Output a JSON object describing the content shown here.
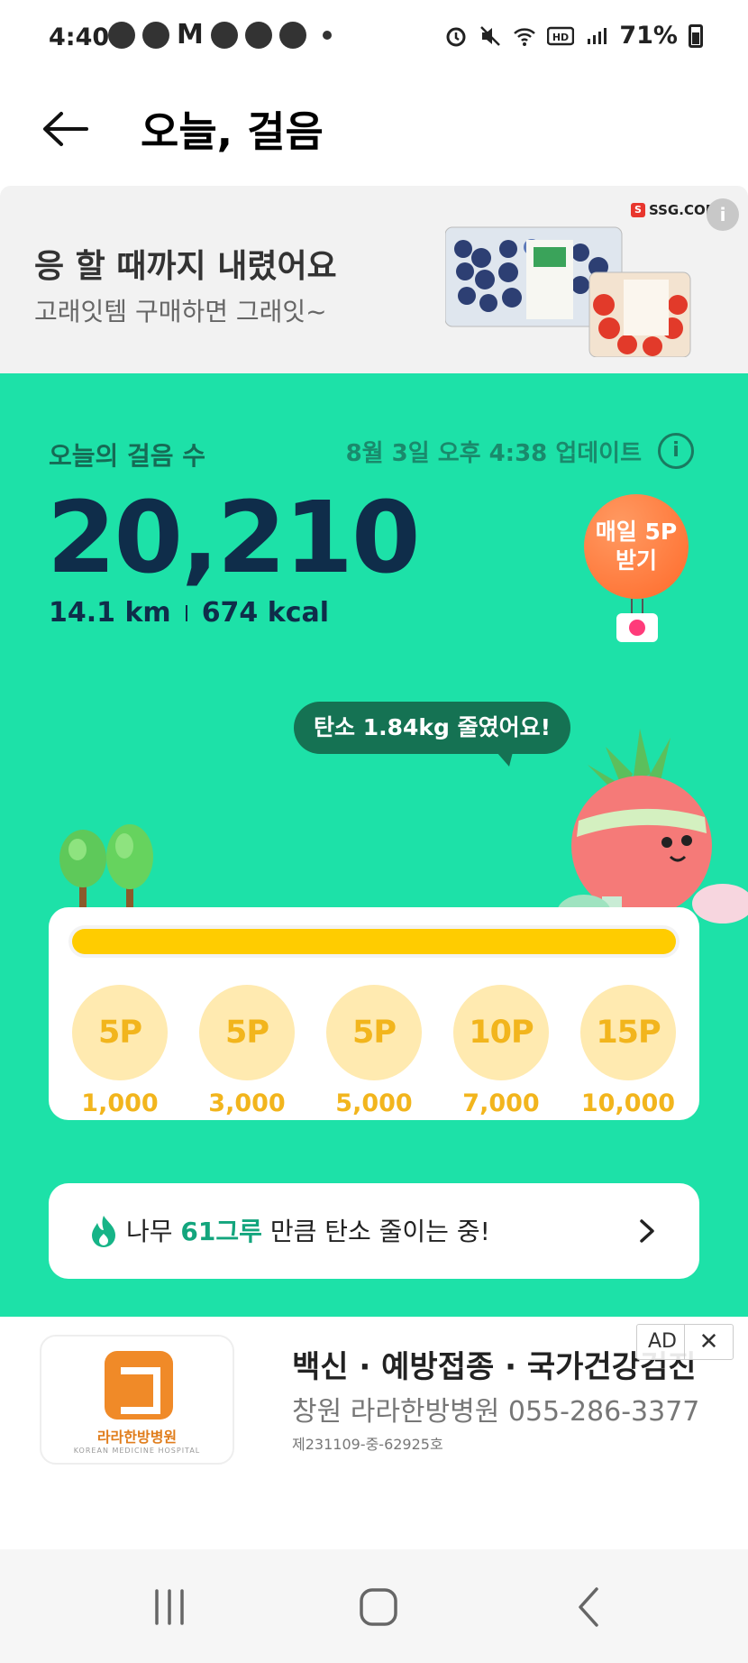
{
  "status_bar": {
    "time": "4:40",
    "notif_letter": "M",
    "battery": "71%"
  },
  "header": {
    "title": "오늘, 걸음"
  },
  "top_ad": {
    "headline": "응 할 때까지 내렸어요",
    "subline": "고래잇템 구매하면 그래잇~",
    "brand": "SSG.COM",
    "info": "i"
  },
  "summary": {
    "label": "오늘의 걸음 수",
    "updated": "8월 3일 오후 4:38 업데이트",
    "steps": "20,210",
    "distance": "14.1 km",
    "calories": "674 kcal",
    "balloon_line1": "매일 5P",
    "balloon_line2": "받기",
    "carbon_bubble": "탄소 1.84kg 줄였어요!",
    "goal_progress_fraction": 1.0
  },
  "milestones": [
    {
      "points": "5P",
      "steps": "1,000"
    },
    {
      "points": "5P",
      "steps": "3,000"
    },
    {
      "points": "5P",
      "steps": "5,000"
    },
    {
      "points": "10P",
      "steps": "7,000"
    },
    {
      "points": "15P",
      "steps": "10,000"
    }
  ],
  "tree_row": {
    "prefix": "나무 ",
    "count": "61그루",
    "suffix": " 만큼 탄소 줄이는 중!"
  },
  "bottom_ad": {
    "logo_name": "라라한방병원",
    "logo_en": "KOREAN MEDICINE HOSPITAL",
    "title": "백신 · 예방접종 · 국가건강검진",
    "subtitle": "창원 라라한방병원 055-286-3377",
    "license": "제231109-중-62925호",
    "badge": "AD",
    "close": "✕"
  },
  "colors": {
    "green_bg": "#1de1a8",
    "steps_text": "#0f2d4a",
    "progress": "#ffcc00",
    "coin": "#ffeab0",
    "coin_text": "#f2b51d",
    "accent_count": "#13a57d"
  }
}
